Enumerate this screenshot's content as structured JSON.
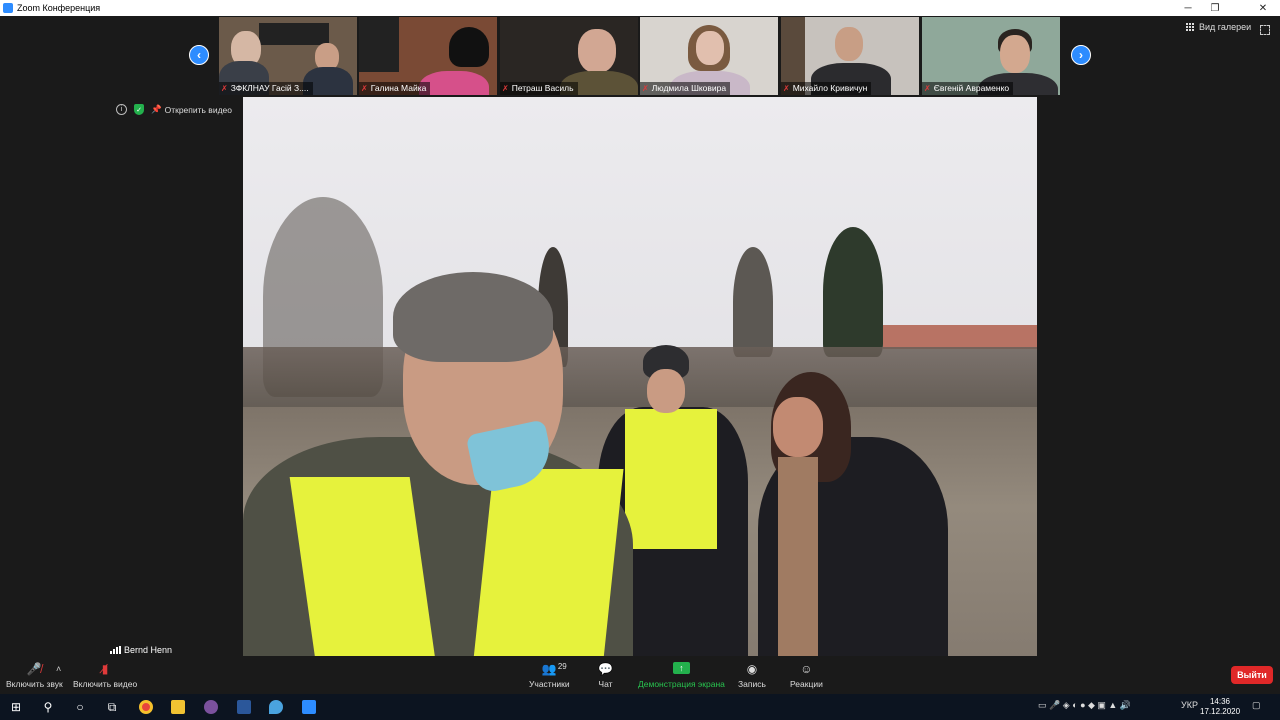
{
  "window": {
    "title": "Zoom Конференция"
  },
  "gallery": {
    "prev_label": "‹",
    "next_label": "›",
    "view_label": "Вид галереи",
    "thumbnails": [
      {
        "name": "ЗФКЛНАУ Гасій З...."
      },
      {
        "name": "Галина Майка"
      },
      {
        "name": "Петраш Василь"
      },
      {
        "name": "Людмила Шковира"
      },
      {
        "name": "Михайло Кривичун"
      },
      {
        "name": "Євгеній Авраменко"
      }
    ]
  },
  "video_info": {
    "unpin_label": "Открепить видео"
  },
  "active_speaker": {
    "name": "Bernd Henn"
  },
  "controls": {
    "audio_label": "Включить звук",
    "video_label": "Включить видео",
    "participants_label": "Участники",
    "participants_count": "29",
    "chat_label": "Чат",
    "share_label": "Демонстрация экрана",
    "record_label": "Запись",
    "reactions_label": "Реакции",
    "leave_label": "Выйти"
  },
  "taskbar": {
    "language": "УКР",
    "time": "14:36",
    "date": "17.12.2020"
  },
  "colors": {
    "accent": "#2d8cff",
    "share_green": "#23b14d",
    "leave_red": "#e02828",
    "muted_red": "#e03a3a"
  }
}
